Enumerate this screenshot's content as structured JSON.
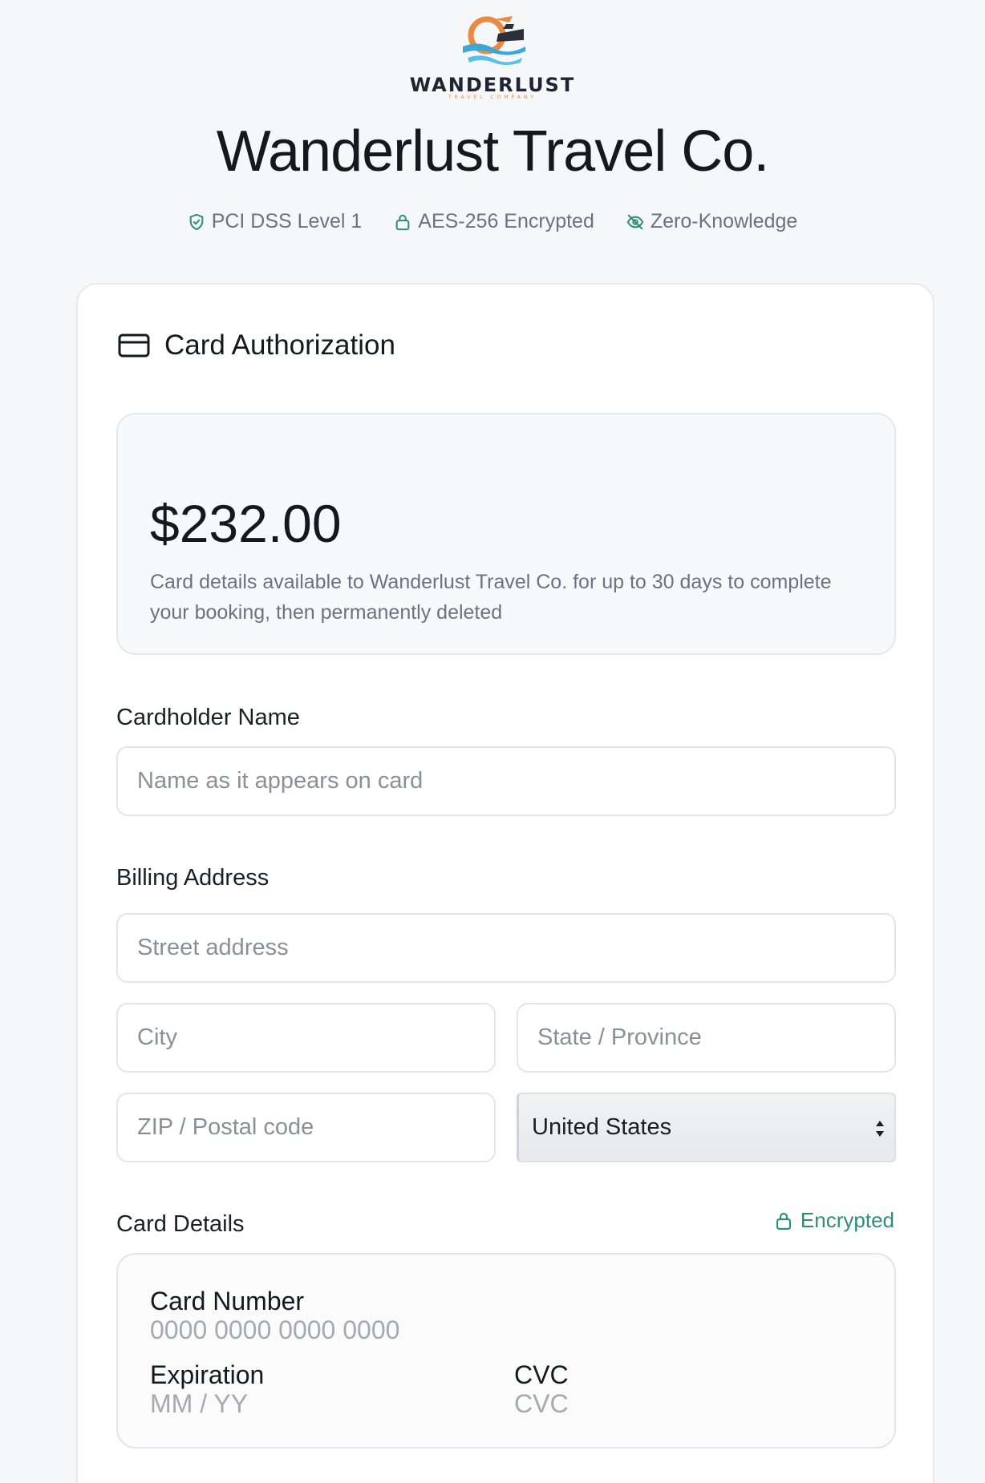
{
  "brand": {
    "logo_word": "WANDERLUST",
    "logo_sub": "TRAVEL COMPANY",
    "title": "Wanderlust Travel Co."
  },
  "badges": [
    {
      "label": "PCI DSS Level 1",
      "icon": "shield-check-icon"
    },
    {
      "label": "AES-256 Encrypted",
      "icon": "lock-icon"
    },
    {
      "label": "Zero-Knowledge",
      "icon": "eye-off-icon"
    }
  ],
  "section": {
    "title": "Card Authorization",
    "icon": "credit-card-icon"
  },
  "amount": {
    "value": "$232.00",
    "note": "Card details available to Wanderlust Travel Co. for up to 30 days to complete your booking, then permanently deleted"
  },
  "cardholder": {
    "label": "Cardholder Name",
    "placeholder": "Name as it appears on card"
  },
  "billing": {
    "label": "Billing Address",
    "street_placeholder": "Street address",
    "city_placeholder": "City",
    "state_placeholder": "State / Province",
    "zip_placeholder": "ZIP / Postal code",
    "country": "United States"
  },
  "card_details": {
    "label": "Card Details",
    "encrypted_label": "Encrypted",
    "number_label": "Card Number",
    "number_placeholder": "0000 0000 0000 0000",
    "expiration_label": "Expiration",
    "expiration_placeholder": "MM / YY",
    "cvc_label": "CVC",
    "cvc_placeholder": "CVC"
  },
  "colors": {
    "accent_green": "#2f8f72",
    "logo_orange": "#e98a43",
    "logo_blue": "#3aa7d6"
  }
}
